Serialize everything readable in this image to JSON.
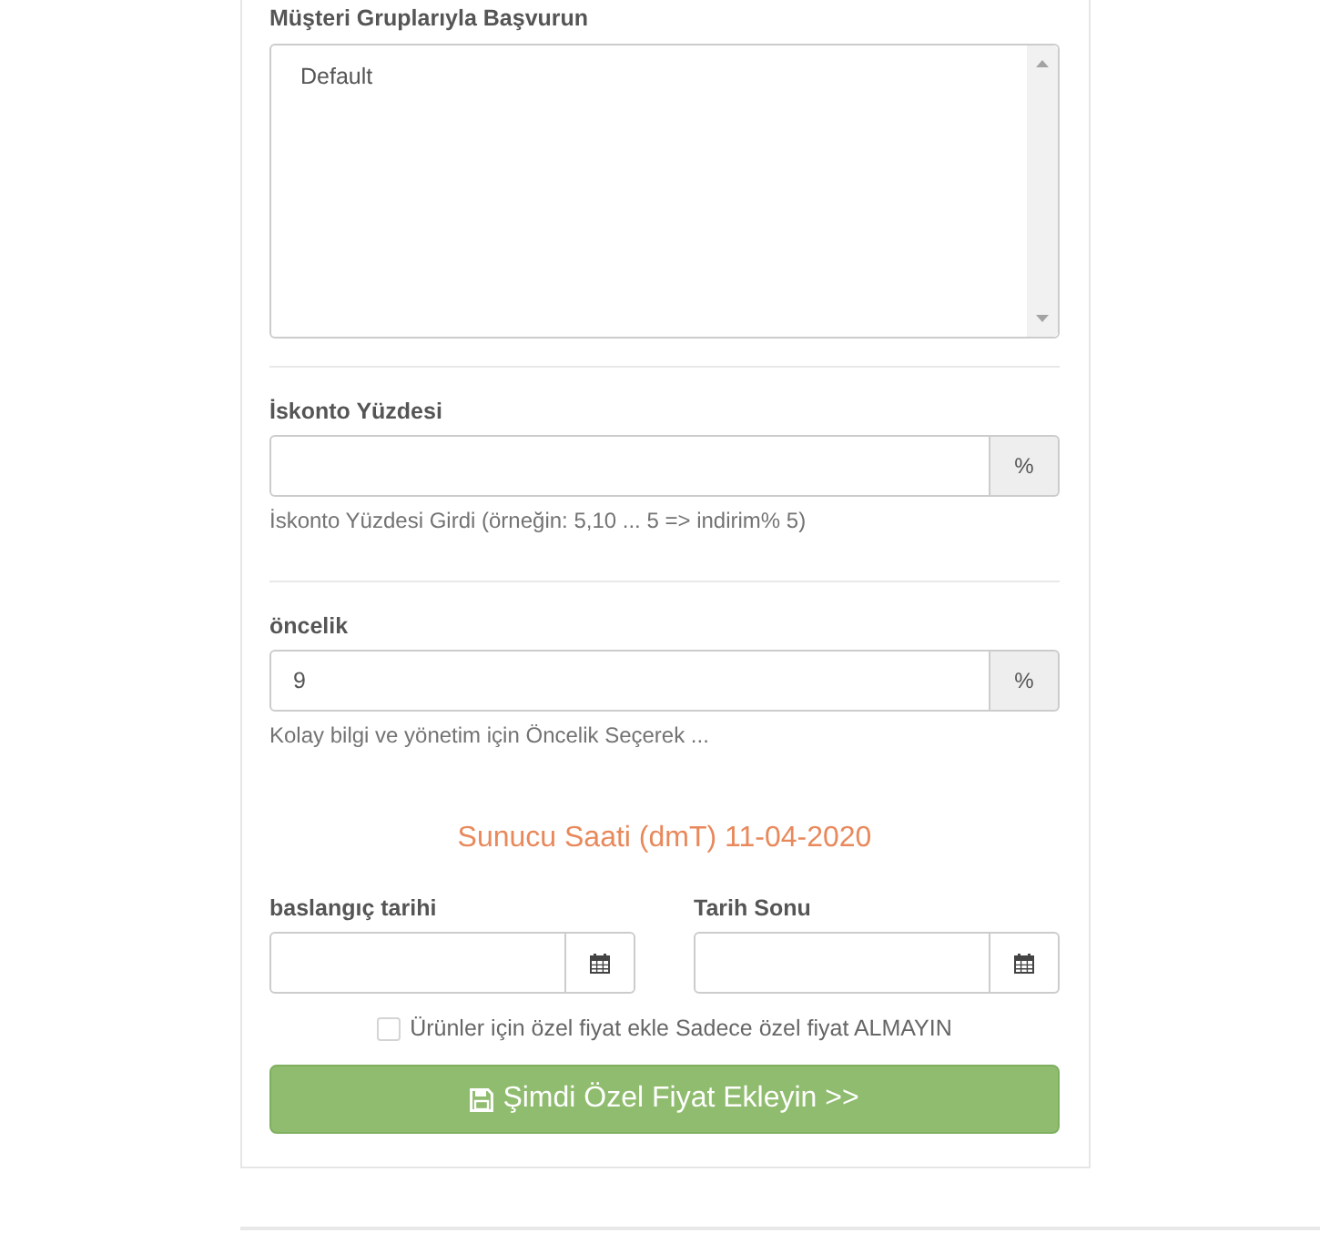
{
  "customer_groups": {
    "label": "Müşteri Gruplarıyla Başvurun",
    "options": [
      {
        "label": "Default",
        "selected": false
      }
    ]
  },
  "discount": {
    "label": "İskonto Yüzdesi",
    "addon": "%",
    "help": "İskonto Yüzdesi Girdi (örneğin: 5,10 ... 5 => indirim% 5)"
  },
  "priority": {
    "label": "öncelik",
    "value": "9",
    "addon": "%",
    "help": "Kolay bilgi ve yönetim için Öncelik Seçerek ..."
  },
  "server_time": "Sunucu Saati (dmT) 11-04-2020",
  "dates": [
    {
      "label": "baslangıç tarihi"
    },
    {
      "label": "Tarih Sonu"
    }
  ],
  "checkbox": {
    "label": "Ürünler için özel fiyat ekle Sadece özel fiyat ALMAYIN",
    "checked": false
  },
  "submit_button": {
    "label": "Şimdi Özel Fiyat Ekleyin >>"
  }
}
